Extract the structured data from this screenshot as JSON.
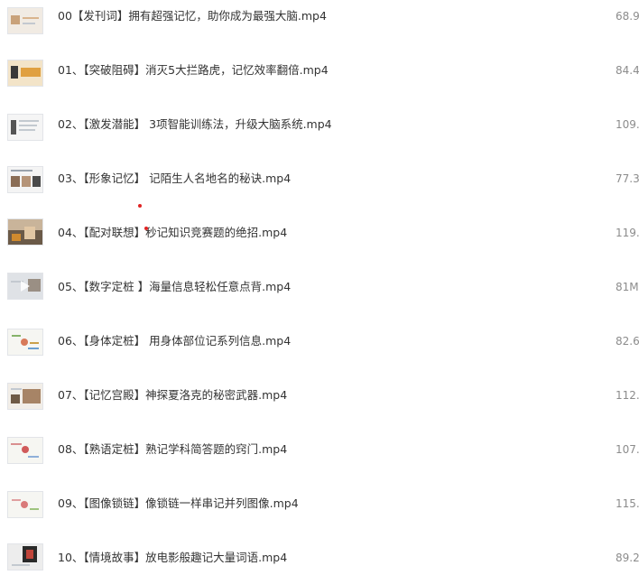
{
  "files": [
    {
      "name": "00【发刊词】拥有超强记忆，助你成为最强大脑.mp4",
      "size": "68.9",
      "thumb": "slide-warm"
    },
    {
      "name": "01、【突破阻碍】消灭5大拦路虎，记忆效率翻倍.mp4",
      "size": "84.4",
      "thumb": "slide-orange"
    },
    {
      "name": "02、【激发潜能】 3项智能训练法，升级大脑系统.mp4",
      "size": "109.",
      "thumb": "slide-text"
    },
    {
      "name": "03、【形象记忆】 记陌生人名地名的秘诀.mp4",
      "size": "77.3",
      "thumb": "slide-photos"
    },
    {
      "name": "04、【配对联想】秒记知识竞赛题的绝招.mp4",
      "size": "119.",
      "thumb": "video-frame"
    },
    {
      "name": "05、【数字定桩 】海量信息轻松任意点背.mp4",
      "size": "81M",
      "thumb": "video-light"
    },
    {
      "name": "06、【身体定桩】 用身体部位记系列信息.mp4",
      "size": "82.6",
      "thumb": "mindmap"
    },
    {
      "name": "07、【记忆宫殿】神探夏洛克的秘密武器.mp4",
      "size": "112.",
      "thumb": "slide-room"
    },
    {
      "name": "08、【熟语定桩】熟记学科简答题的窍门.mp4",
      "size": "107.",
      "thumb": "mindmap"
    },
    {
      "name": "09、【图像锁链】像锁链一样串记并列图像.mp4",
      "size": "115.",
      "thumb": "mindmap"
    },
    {
      "name": "10、【情境故事】放电影般趣记大量词语.mp4",
      "size": "89.2",
      "thumb": "slide-dark"
    }
  ],
  "colors": {
    "text": "#333333",
    "size_text": "#8c8c8c",
    "annotation_dot": "#e02424"
  }
}
